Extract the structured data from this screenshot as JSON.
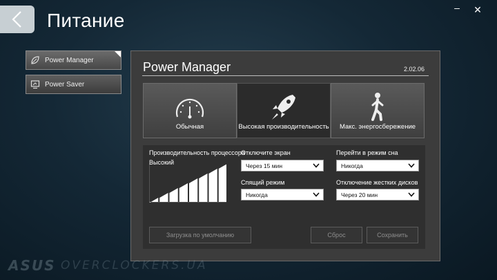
{
  "header": {
    "title": "Питание",
    "minimize_label": "–",
    "close_label": "✕"
  },
  "sidebar": {
    "items": [
      {
        "label": "Power Manager",
        "icon": "leaf-icon",
        "active": true
      },
      {
        "label": "Power Saver",
        "icon": "monitor-icon",
        "active": false
      }
    ]
  },
  "panel": {
    "title": "Power Manager",
    "version": "2.02.06",
    "modes": [
      {
        "label": "Обычная",
        "icon": "gauge-icon",
        "selected": false
      },
      {
        "label": "Высокая производительность",
        "icon": "rocket-icon",
        "selected": true
      },
      {
        "label": "Макс. энергосбережение",
        "icon": "walking-person-icon",
        "selected": false
      }
    ],
    "cpu": {
      "label": "Производительность процессора",
      "level_label": "Высокий",
      "bars_total": 8,
      "bars_filled": 8
    },
    "display_off": {
      "label": "Отключите экран",
      "value": "Через 15 мин"
    },
    "sleep_mode": {
      "label": "Перейти в режим сна",
      "value": "Никогда"
    },
    "standby": {
      "label": "Спящий режим",
      "value": "Никогда"
    },
    "hdd_off": {
      "label": "Отключение жестких дисков",
      "value": "Через 20 мин"
    },
    "buttons": {
      "default": "Загрузка по умолчанию",
      "reset": "Сброс",
      "save": "Сохранить"
    }
  },
  "watermark": {
    "brand": "ASUS",
    "site": "OVERCLOCKERS.UA"
  },
  "colors": {
    "accent": "#c7cfd3",
    "panel": "#3c3c3c",
    "background": "#142836"
  }
}
